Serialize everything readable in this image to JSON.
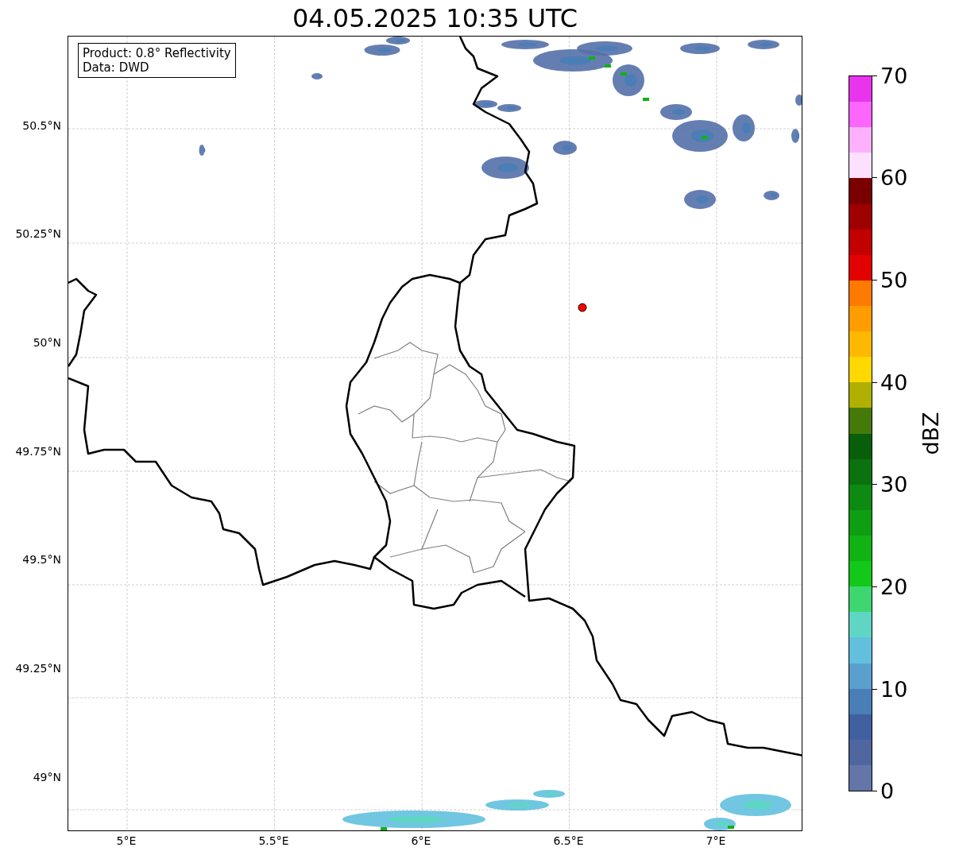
{
  "title": "04.05.2025 10:35 UTC",
  "map": {
    "info_lines": [
      "Product: 0.8° Reflectivity",
      "Data: DWD"
    ],
    "xticks": [
      "5°E",
      "5.5°E",
      "6°E",
      "6.5°E",
      "7°E"
    ],
    "yticks": [
      "50.5°N",
      "50.25°N",
      "50°N",
      "49.75°N",
      "49.5°N",
      "49.25°N",
      "49°N"
    ]
  },
  "colorbar": {
    "label": "dBZ",
    "ticks": [
      "70",
      "60",
      "50",
      "40",
      "30",
      "20",
      "10",
      "0"
    ],
    "bands": [
      {
        "color": "#e934ee"
      },
      {
        "color": "#fc66fd"
      },
      {
        "color": "#fdb1fd"
      },
      {
        "color": "#fde0fd"
      },
      {
        "color": "#7a0000"
      },
      {
        "color": "#9e0000"
      },
      {
        "color": "#c20000"
      },
      {
        "color": "#e30000"
      },
      {
        "color": "#ff7a00"
      },
      {
        "color": "#ff9c00"
      },
      {
        "color": "#ffb800"
      },
      {
        "color": "#ffd800"
      },
      {
        "color": "#b0b000"
      },
      {
        "color": "#457a0a"
      },
      {
        "color": "#095e0a"
      },
      {
        "color": "#0a720f"
      },
      {
        "color": "#0d8a12"
      },
      {
        "color": "#0e9e12"
      },
      {
        "color": "#10b214"
      },
      {
        "color": "#12c818"
      },
      {
        "color": "#3ed670"
      },
      {
        "color": "#5fd6c4"
      },
      {
        "color": "#62c0de"
      },
      {
        "color": "#5aa0cc"
      },
      {
        "color": "#4a7eb6"
      },
      {
        "color": "#4160a0"
      },
      {
        "color": "#50669e"
      },
      {
        "color": "#6476a8"
      }
    ]
  }
}
